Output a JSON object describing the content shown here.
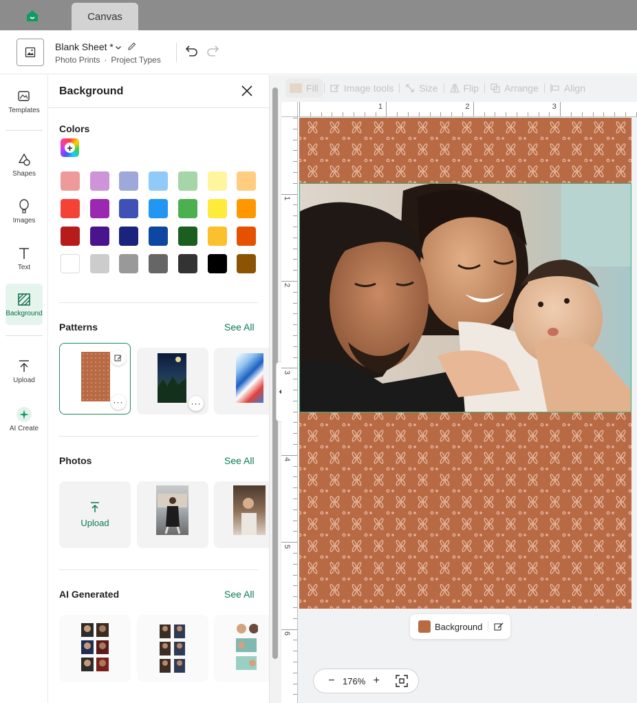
{
  "tabs": {
    "home_icon": "home-icon",
    "active_tab": "Canvas"
  },
  "header": {
    "doc_title": "Blank Sheet *",
    "breadcrumb_1": "Photo Prints",
    "breadcrumb_sep": "·",
    "breadcrumb_2": "Project Types"
  },
  "rail": {
    "templates": "Templates",
    "shapes": "Shapes",
    "images": "Images",
    "text": "Text",
    "background": "Background",
    "upload": "Upload",
    "ai_create": "AI Create"
  },
  "panel": {
    "title": "Background",
    "colors_title": "Colors",
    "color_rows": [
      [
        "#ef9a9a",
        "#ce93d8",
        "#9fa8da",
        "#90caf9",
        "#a5d6a7",
        "#fff59d",
        "#ffcc80"
      ],
      [
        "#f44336",
        "#9c27b0",
        "#3f51b5",
        "#2196f3",
        "#4caf50",
        "#ffeb3b",
        "#ff9800"
      ],
      [
        "#b71c1c",
        "#4a148c",
        "#1a237e",
        "#0d47a1",
        "#1b5e20",
        "#fbc02d",
        "#e65100"
      ],
      [
        "#ffffff",
        "#cccccc",
        "#999999",
        "#666666",
        "#333333",
        "#000000",
        "#8d5304"
      ]
    ],
    "patterns_title": "Patterns",
    "photos_title": "Photos",
    "ai_title": "AI Generated",
    "see_all": "See All",
    "upload_label": "Upload"
  },
  "toolbar": {
    "fill": "Fill",
    "image_tools": "Image tools",
    "size": "Size",
    "flip": "Flip",
    "arrange": "Arrange",
    "align": "Align"
  },
  "ruler": {
    "top": [
      "1",
      "2",
      "3"
    ],
    "left": [
      "1",
      "2",
      "3",
      "4",
      "5",
      "6"
    ]
  },
  "canvas": {
    "background_chip": "Background",
    "zoom": "176%",
    "pattern_color": "#b86a45",
    "frame_color": "#36b37e"
  },
  "accent": "#0a7a50"
}
